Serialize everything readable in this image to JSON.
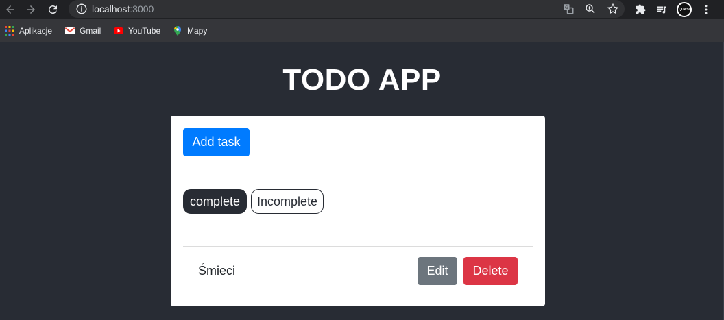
{
  "browser": {
    "url_host": "localhost",
    "url_port": ":3000",
    "icons": {
      "back": "arrow-left-icon",
      "forward": "arrow-right-icon",
      "reload": "reload-icon",
      "site_info": "info-icon",
      "translate": "translate-icon",
      "zoom": "zoom-icon",
      "bookmark_star": "star-icon",
      "extensions": "puzzle-icon",
      "media": "playlist-icon",
      "menu": "kebab-menu-icon"
    },
    "profile_label": "QUASI"
  },
  "bookmarks": [
    {
      "label": "Aplikacje",
      "icon": "apps-grid-icon"
    },
    {
      "label": "Gmail",
      "icon": "gmail-icon"
    },
    {
      "label": "YouTube",
      "icon": "youtube-icon"
    },
    {
      "label": "Mapy",
      "icon": "maps-pin-icon"
    }
  ],
  "app": {
    "title": "TODO APP",
    "add_task_label": "Add task",
    "filters": {
      "complete": "complete",
      "incomplete": "Incomplete"
    },
    "tasks": [
      {
        "text": "Śmieci",
        "completed": true,
        "edit_label": "Edit",
        "delete_label": "Delete"
      }
    ]
  },
  "colors": {
    "page_bg": "#282c34",
    "primary": "#007bff",
    "secondary": "#6c757d",
    "danger": "#dc3545"
  }
}
